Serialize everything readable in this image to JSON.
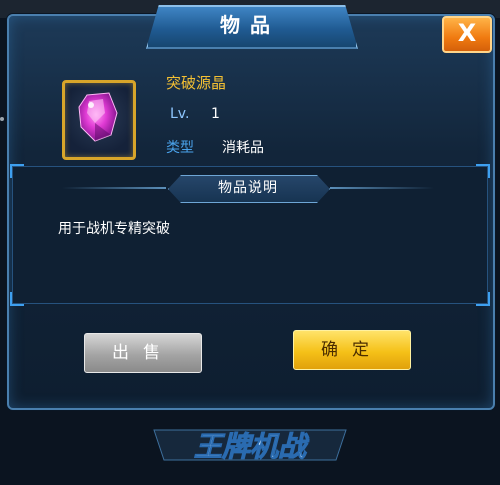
{
  "dialog": {
    "title": "物品",
    "close_label": "X"
  },
  "item": {
    "name": "突破源晶",
    "level_label": "Lv.",
    "level_value": "1",
    "type_label": "类型",
    "type_value": "消耗品",
    "icon": "pink-crystal-icon"
  },
  "description": {
    "title": "物品说明",
    "text": "用于战机专精突破"
  },
  "buttons": {
    "sell_label": "出售",
    "confirm_label": "确定"
  },
  "logo": {
    "text": "王牌机战"
  },
  "colors": {
    "item_name": "#f3c033",
    "type_label": "#4aa2ea",
    "confirm_button": "#f5c118",
    "sell_button": "#a4a4a4",
    "close_button": "#f07a10"
  }
}
